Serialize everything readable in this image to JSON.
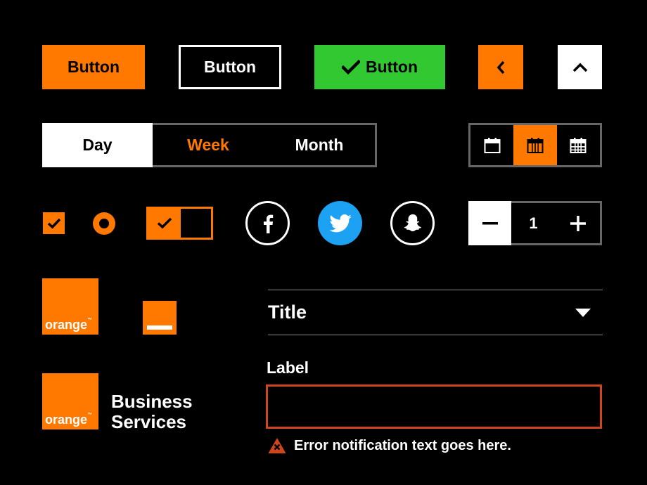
{
  "buttons": {
    "primary_label": "Button",
    "outline_label": "Button",
    "success_label": "Button",
    "back_icon": "chevron-left-icon",
    "up_icon": "chevron-up-icon"
  },
  "segmented": {
    "options": [
      "Day",
      "Week",
      "Month"
    ],
    "selected": "Day"
  },
  "calendar_views": {
    "options": [
      "calendar-day-icon",
      "calendar-week-icon",
      "calendar-month-icon"
    ],
    "selected": 1
  },
  "controls": {
    "checkbox_checked": true,
    "radio_selected": true,
    "toggle_on": true
  },
  "social": [
    "facebook-icon",
    "twitter-icon",
    "snapchat-icon"
  ],
  "stepper": {
    "value": "1"
  },
  "logos": {
    "orange_text": "orange",
    "tm": "™",
    "business_line1": "Business",
    "business_line2": "Services"
  },
  "form": {
    "select_title": "Title",
    "field_label": "Label",
    "input_value": "",
    "error_text": "Error notification text goes here."
  },
  "colors": {
    "brand_orange": "#ff7900",
    "success_green": "#32c832",
    "twitter_blue": "#1da1f2",
    "error_red": "#d0451b",
    "border_gray": "#666666"
  }
}
